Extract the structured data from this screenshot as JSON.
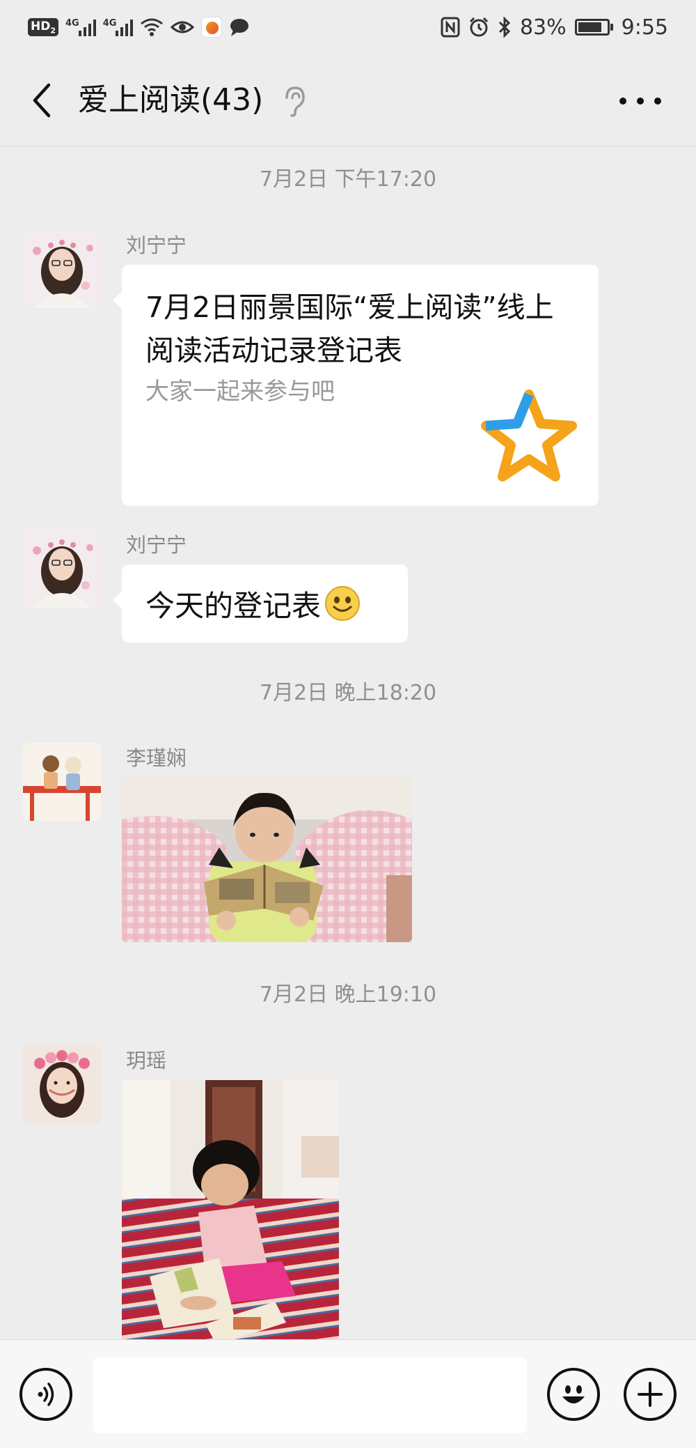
{
  "status_bar": {
    "hd_label": "HD",
    "hd_sub": "2",
    "network_label_1": "4G",
    "network_label_2": "4G",
    "battery_text": "83%",
    "battery_level": 0.83,
    "time": "9:55",
    "left_icons": [
      "hd-icon",
      "signal-icon",
      "signal-icon",
      "wifi-icon",
      "eye-icon",
      "app-notification-icon",
      "chat-bubble-icon"
    ],
    "right_icons": [
      "nfc-icon",
      "alarm-icon",
      "bluetooth-icon",
      "battery-icon"
    ]
  },
  "header": {
    "title": "爱上阅读(43)",
    "icons": [
      "back-icon",
      "ear-icon",
      "more-icon"
    ]
  },
  "messages": [
    {
      "timestamp": "7月2日 下午17:20"
    },
    {
      "sender": "刘宁宁",
      "type": "link",
      "title": "7月2日丽景国际“爱上阅读”线上阅读活动记录登记表",
      "description": "大家一起来参与吧",
      "thumbnail_icon": "star-icon"
    },
    {
      "sender": "刘宁宁",
      "type": "text",
      "text": "今天的登记表",
      "emoji": "smile-emoji-icon"
    },
    {
      "timestamp": "7月2日 晚上18:20"
    },
    {
      "sender": "李瑾娴",
      "type": "image",
      "description": "photo"
    },
    {
      "timestamp": "7月2日 晚上19:10"
    },
    {
      "sender": "玥瑶",
      "type": "image",
      "description": "photo"
    }
  ],
  "input_bar": {
    "value": "",
    "icons": [
      "voice-icon",
      "emoji-icon",
      "plus-icon"
    ]
  },
  "colors": {
    "background": "#ededed",
    "bubble": "#ffffff",
    "timestamp_text": "#909090",
    "sender_text": "#8a8a8a",
    "link_desc": "#999999"
  }
}
